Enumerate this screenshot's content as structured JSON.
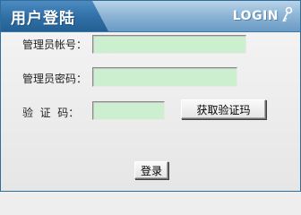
{
  "header": {
    "title": "用户登陆",
    "logo_text": "LOGIN",
    "logo_icon": "key-icon"
  },
  "form": {
    "username_label": "管理员帐号：",
    "username_value": "",
    "password_label": "管理员密码：",
    "password_value": "",
    "captcha_label": "验  证  码：",
    "captcha_value": "",
    "get_captcha_label": "获取验证玛",
    "submit_label": "登录"
  },
  "colors": {
    "header_blue": "#2f6fa6",
    "field_green": "#ccefd0"
  }
}
